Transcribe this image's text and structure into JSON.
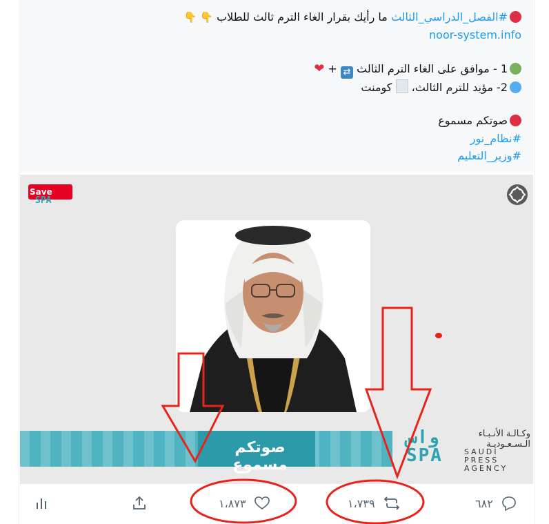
{
  "tweet": {
    "line1_hashtag": "#الفصل_الدراسي_الثالث",
    "line1_text": " ما رأيك بقرار الغاء الترم ثالث للطلاب",
    "line1_emoji": "👇 👇",
    "link": "noor-system.info",
    "option1_text": "1 - موافق على الغاء الترم الثالث",
    "option1_plus": " + ",
    "option2_text": "2- مؤيد للترم الثالث، ",
    "option2_suffix": " كومنت",
    "vote_text": "صوتكم مسموع",
    "hashtag_nour": "#نظام_نور",
    "hashtag_minister": "#وزير_التعليم"
  },
  "media": {
    "save_label": "Save",
    "banner_text": "صوتكم مسموع",
    "spa_mark_top": "واس",
    "spa_mark_bottom": "SPA",
    "spa_arabic_line1": "وكـالـة الأنـبـاء",
    "spa_arabic_line2": "الـسـعـوديـة",
    "spa_english_line1": "SAUDI PRESS",
    "spa_english_line2": "AGENCY",
    "mini_logo": "SPA"
  },
  "actions": {
    "replies": "٦٨٢",
    "retweets": "١،٧٣٩",
    "likes": "١،٨٧٣"
  },
  "colors": {
    "link": "#1d9bf0",
    "banner": "#4fb3c2",
    "annotation": "#e8221c",
    "icon": "#536471"
  },
  "icons": [
    "repeat-emoji-icon",
    "heart-emoji-icon",
    "scroll-emoji-icon",
    "analytics-icon",
    "share-icon",
    "like-icon",
    "retweet-icon",
    "reply-icon",
    "expand-icon"
  ]
}
